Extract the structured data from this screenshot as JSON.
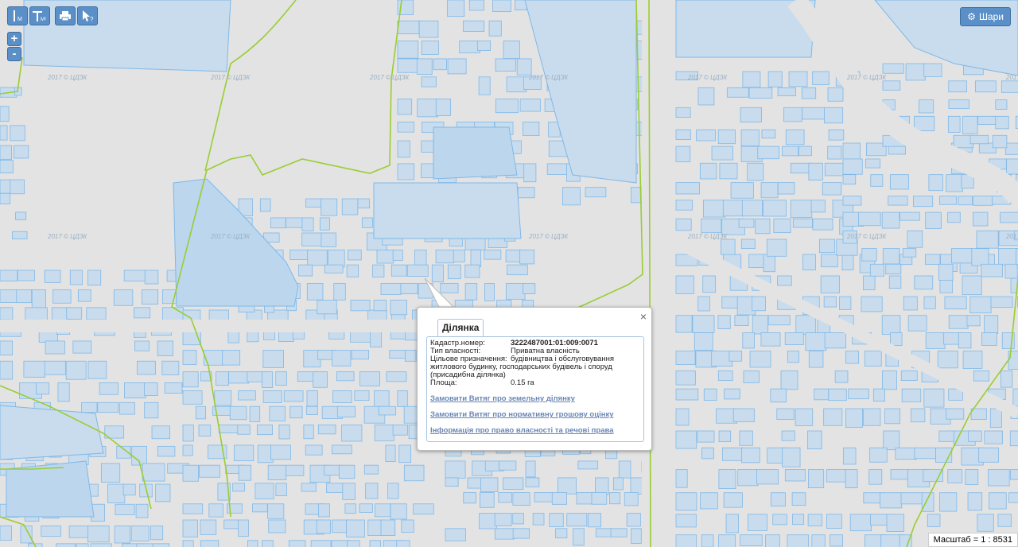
{
  "toolbar": {
    "measure_length_label": "M",
    "measure_area_label": "M²",
    "print_icon": "print-icon",
    "identify_icon": "identify-cursor-icon"
  },
  "zoom": {
    "in_label": "+",
    "out_label": "-"
  },
  "layers_button": {
    "label": "Шари",
    "icon": "gear-icon"
  },
  "watermark": "2017 © ЦДЗК",
  "popup": {
    "tab_label": "Ділянка",
    "close_label": "×",
    "fields": [
      {
        "label": "Кадастр.номер:",
        "value": "3222487001:01:009:0071",
        "bold": true
      },
      {
        "label": "Тип власності:",
        "value": "Приватна власність"
      },
      {
        "label": "Цільове призначення:",
        "value": "будівництва і обслуговування"
      }
    ],
    "purpose_continuation": "житлового будинку, господарських будівель і споруд (присадибна ділянка)",
    "area": {
      "label": "Площа:",
      "value": "0.15 га"
    },
    "links": [
      "Замовити Витяг про земельну ділянку",
      "Замовити Витяг про нормативну грошову оцінку",
      "Інформація про право власності та речові права"
    ]
  },
  "scale": "Масштаб = 1 : 8531",
  "colors": {
    "parcel_fill": "#c8dced",
    "parcel_stroke": "#7fb8e8",
    "boundary": "#9acd32",
    "background": "#e3e3e3"
  }
}
